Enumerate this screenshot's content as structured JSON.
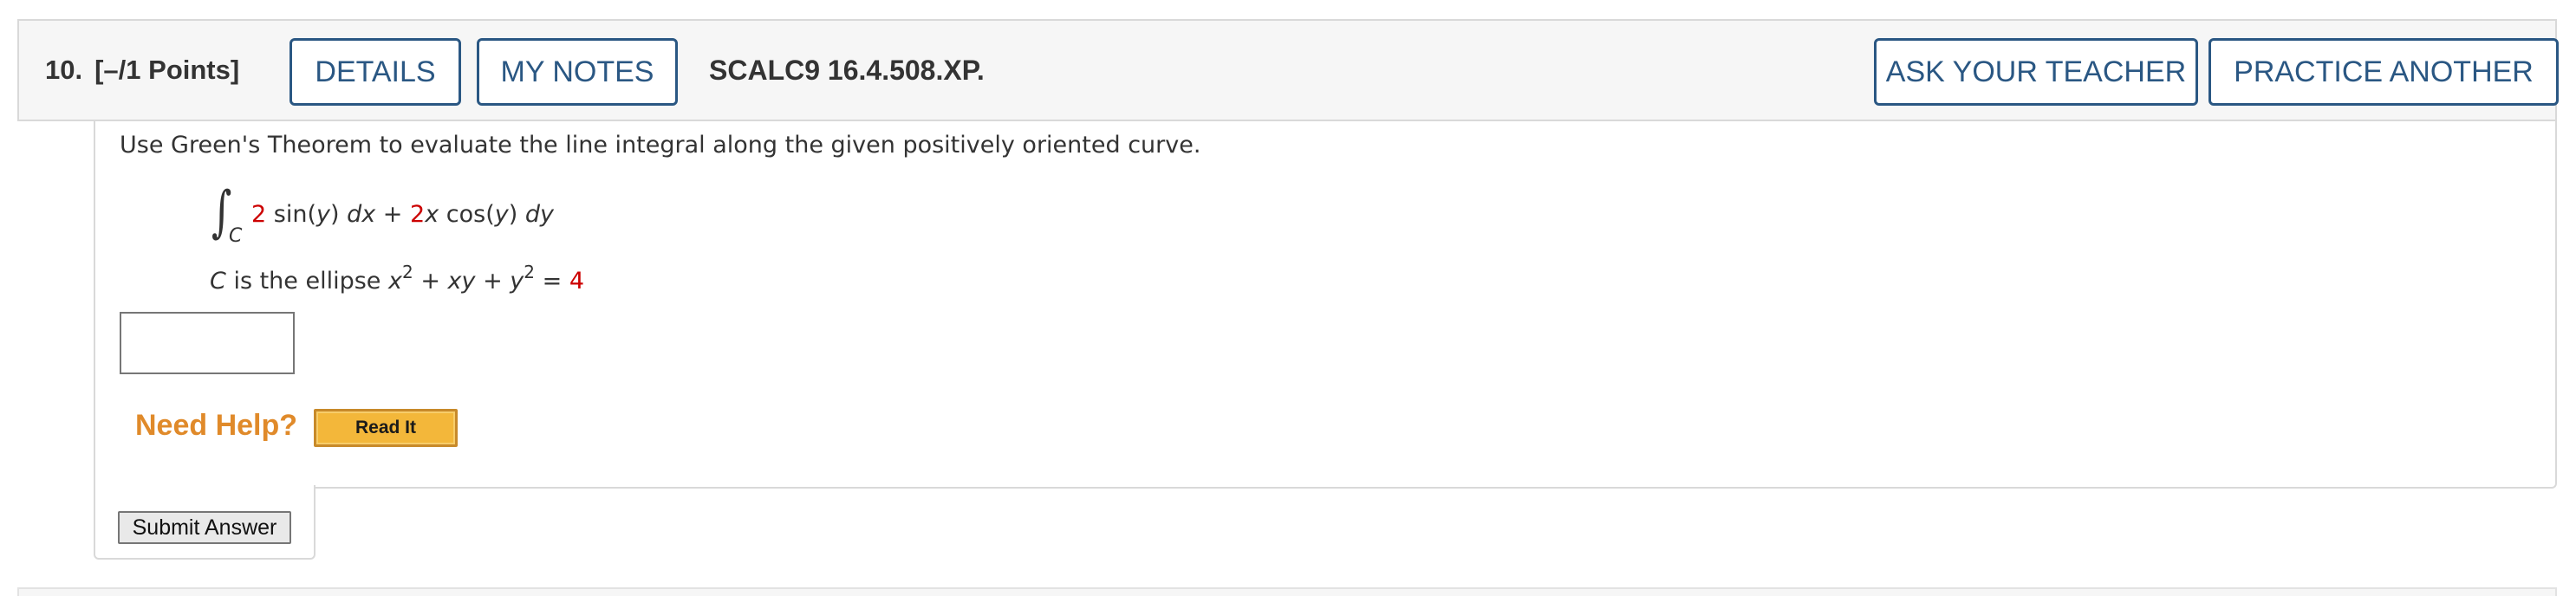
{
  "question": {
    "number": "10.",
    "points": "[–/1 Points]",
    "code": "SCALC9 16.4.508.XP."
  },
  "header_buttons": {
    "details": "DETAILS",
    "my_notes": "MY NOTES",
    "ask_teacher": "ASK YOUR TEACHER",
    "practice_another": "PRACTICE ANOTHER"
  },
  "body": {
    "instruction": "Use Green's Theorem to evaluate the line integral along the given positively oriented curve.",
    "integral": {
      "sign": "∫",
      "subscript": "C",
      "coef1": "2",
      "term1": " sin(",
      "var_y1": "y",
      "term1b": ") ",
      "dx": "dx",
      "plus": " + ",
      "coef2": "2",
      "var_x": "x",
      "term2": " cos(",
      "var_y2": "y",
      "term2b": ") ",
      "dy": "dy"
    },
    "curve": {
      "var_c": "C",
      "text": " is the ellipse ",
      "x": "x",
      "exp1": "2",
      "plus1": " + ",
      "xy": "xy",
      "plus2": " + ",
      "y": "y",
      "exp2": "2",
      "eq": " = ",
      "rhs": "4"
    },
    "answer_value": ""
  },
  "help": {
    "label": "Need Help?",
    "read_it": "Read It"
  },
  "submit_label": "Submit Answer",
  "colors": {
    "accent": "#2a5783",
    "highlight": "#cc0000",
    "help": "#e08a2a"
  }
}
